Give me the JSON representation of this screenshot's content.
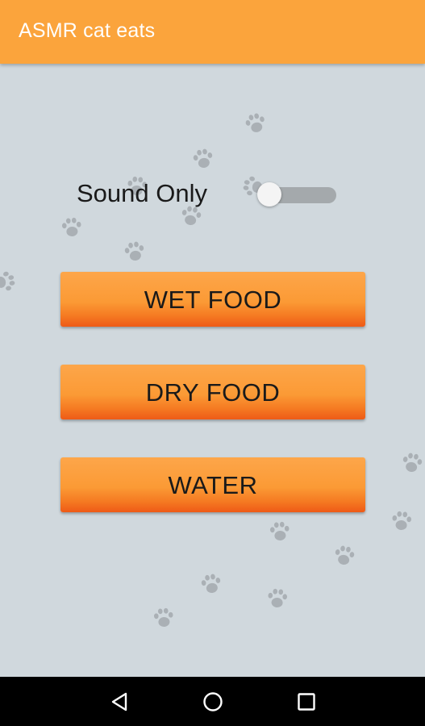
{
  "app": {
    "title": "ASMR cat eats",
    "accent_color": "#fba43c"
  },
  "controls": {
    "sound_only": {
      "label": "Sound Only",
      "state": "off"
    },
    "buttons": [
      {
        "label": "WET FOOD"
      },
      {
        "label": "DRY FOOD"
      },
      {
        "label": "WATER"
      }
    ]
  },
  "background": {
    "decoration_icon": "paw-print-icon"
  },
  "nav": {
    "back_icon": "back-triangle-icon",
    "home_icon": "home-circle-icon",
    "recents_icon": "recents-square-icon"
  }
}
